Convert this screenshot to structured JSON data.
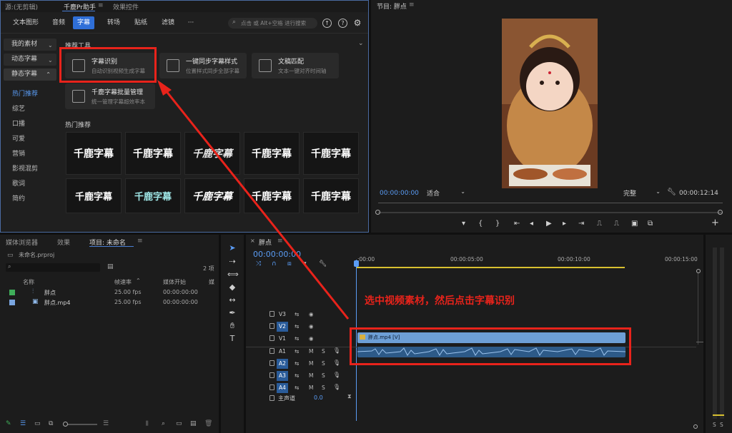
{
  "plugin": {
    "top_tabs": [
      "源:(无剪辑)",
      "千鹿Pr助手",
      "效果控件"
    ],
    "nav_tabs": [
      "文本图形",
      "音频",
      "字幕",
      "转场",
      "贴纸",
      "滤镜",
      "···"
    ],
    "active_tab": "字幕",
    "search_placeholder": "点击 或 Alt+空格 进行搜索",
    "sidebar_buttons": [
      "我的素材",
      "动态字幕",
      "静态字幕"
    ],
    "sidebar_items": [
      "热门推荐",
      "综艺",
      "口播",
      "可爱",
      "营销",
      "影视混剪",
      "歌词",
      "简约"
    ],
    "section_tools": "推荐工具",
    "tools": [
      {
        "title": "字幕识别",
        "desc": "自动识别视频生成字幕"
      },
      {
        "title": "一键同步字幕样式",
        "desc": "位置样式同步全部字幕"
      },
      {
        "title": "文稿匹配",
        "desc": "文本一键对齐时间轴"
      },
      {
        "title": "千鹿字幕批量管理",
        "desc": "统一管理字幕超效率本"
      }
    ],
    "section_hot": "热门推荐",
    "tiles": [
      "千鹿字幕",
      "千鹿字幕",
      "千鹿字幕",
      "千鹿字幕",
      "千鹿字幕",
      "千鹿字幕",
      "千鹿字幕",
      "千鹿字幕",
      "千鹿字幕",
      "千鹿字幕"
    ],
    "tile_colors": [
      "#ffffff",
      "#ffffff",
      "#e8e8e8",
      "#ffffff",
      "#ffffff",
      "#ffffff",
      "#9fe6e6",
      "#ffffff",
      "#ffffff",
      "#ffffff"
    ]
  },
  "program": {
    "title": "节目: 胖点",
    "timecode": "00:00:00:00",
    "fit": "适合",
    "quality": "完整",
    "duration": "00:00:12:14"
  },
  "project": {
    "tabs": [
      "媒体浏览器",
      "效果",
      "项目: 未命名"
    ],
    "file": "未命名.prproj",
    "count": "2 项",
    "columns": [
      "名称",
      "帧速率",
      "媒体开始",
      "媒"
    ],
    "rows": [
      {
        "name": "胖点",
        "fps": "25.00 fps",
        "start": "00:00:00:00",
        "color": "#3fae5a"
      },
      {
        "name": "胖点.mp4",
        "fps": "25.00 fps",
        "start": "00:00:00:00",
        "color": "#7aa6e0"
      }
    ]
  },
  "timeline": {
    "tab": "胖点",
    "timecode": "00:00:00:00",
    "ruler": [
      ":00:00",
      "00:00:05:00",
      "00:00:10:00",
      "00:00:15:00"
    ],
    "video_tracks": [
      "V3",
      "V2",
      "V1"
    ],
    "audio_tracks": [
      "A1",
      "A2",
      "A3",
      "A4"
    ],
    "master": "主声道",
    "master_value": "0.0",
    "clip_label": "胖点.mp4 [V]",
    "annotation": "选中视频素材，然后点击字幕识别",
    "m_label": "M",
    "s_label": "S"
  },
  "meter": {
    "labels": [
      "S",
      "S"
    ]
  },
  "colors": {
    "accent": "#2f6fd8",
    "highlight": "#e8231b",
    "clip_video": "#6d9fd6",
    "clip_audio": "#2d5a88"
  }
}
